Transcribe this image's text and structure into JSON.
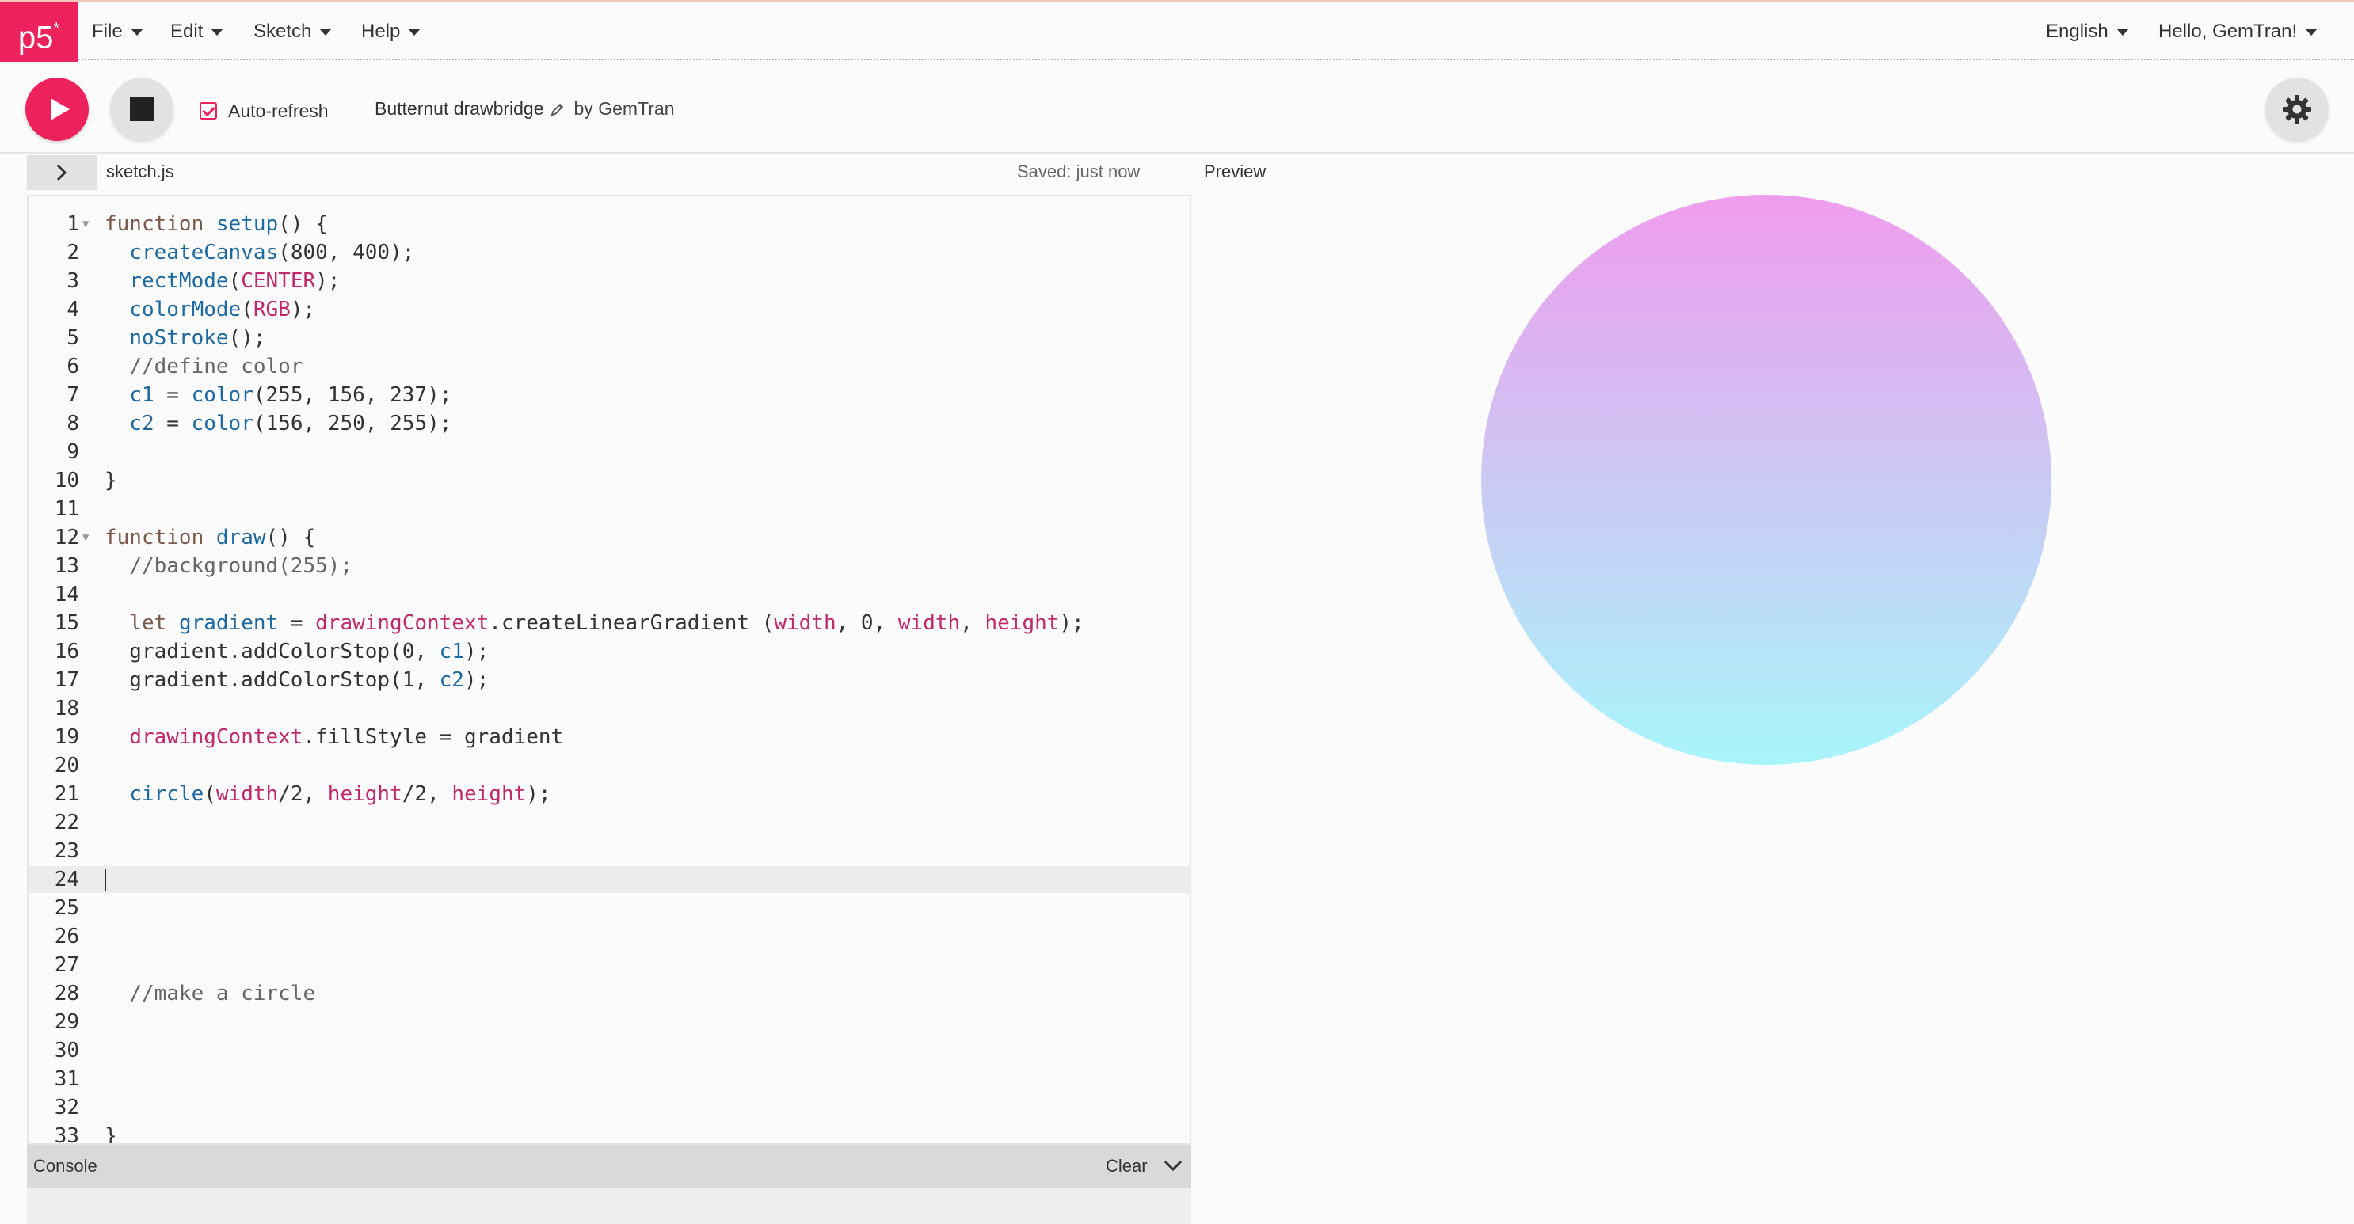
{
  "nav": {
    "logo": "p5*",
    "menus": [
      "File",
      "Edit",
      "Sketch",
      "Help"
    ],
    "language": "English",
    "user_greeting": "Hello, GemTran!"
  },
  "toolbar": {
    "play_icon": "play-icon",
    "stop_icon": "stop-icon",
    "auto_refresh_label": "Auto-refresh",
    "auto_refresh_checked": true,
    "sketch_name": "Butternut drawbridge",
    "by_label": "by",
    "author": "GemTran",
    "settings_icon": "gear-icon"
  },
  "editor_header": {
    "filename": "sketch.js",
    "saved_status": "Saved: just now",
    "preview_label": "Preview"
  },
  "editor": {
    "active_line": 24,
    "lines": [
      {
        "n": "1",
        "text": "function setup() {"
      },
      {
        "n": "2",
        "text": "  createCanvas(800, 400);"
      },
      {
        "n": "3",
        "text": "  rectMode(CENTER);"
      },
      {
        "n": "4",
        "text": "  colorMode(RGB);"
      },
      {
        "n": "5",
        "text": "  noStroke();"
      },
      {
        "n": "6",
        "text": "  //define color"
      },
      {
        "n": "7",
        "text": "  c1 = color(255, 156, 237);"
      },
      {
        "n": "8",
        "text": "  c2 = color(156, 250, 255);"
      },
      {
        "n": "9",
        "text": ""
      },
      {
        "n": "10",
        "text": "}"
      },
      {
        "n": "11",
        "text": ""
      },
      {
        "n": "12",
        "text": "function draw() {"
      },
      {
        "n": "13",
        "text": "  //background(255);"
      },
      {
        "n": "14",
        "text": ""
      },
      {
        "n": "15",
        "text": "  let gradient = drawingContext.createLinearGradient (width, 0, width, height);"
      },
      {
        "n": "16",
        "text": "  gradient.addColorStop(0, c1);"
      },
      {
        "n": "17",
        "text": "  gradient.addColorStop(1, c2);"
      },
      {
        "n": "18",
        "text": ""
      },
      {
        "n": "19",
        "text": "  drawingContext.fillStyle = gradient"
      },
      {
        "n": "20",
        "text": ""
      },
      {
        "n": "21",
        "text": "  circle(width/2, height/2, height);"
      },
      {
        "n": "22",
        "text": ""
      },
      {
        "n": "23",
        "text": ""
      },
      {
        "n": "24",
        "text": ""
      },
      {
        "n": "25",
        "text": ""
      },
      {
        "n": "26",
        "text": ""
      },
      {
        "n": "27",
        "text": ""
      },
      {
        "n": "28",
        "text": "  //make a circle"
      },
      {
        "n": "29",
        "text": ""
      },
      {
        "n": "30",
        "text": ""
      },
      {
        "n": "31",
        "text": ""
      },
      {
        "n": "32",
        "text": ""
      },
      {
        "n": "33",
        "text": "}"
      }
    ],
    "fold_lines": [
      1,
      12
    ]
  },
  "console": {
    "label": "Console",
    "clear_label": "Clear"
  },
  "preview": {
    "gradient_top": "#ef9ced",
    "gradient_bottom": "#a8f5fb"
  },
  "colors": {
    "accent": "#ed225d",
    "keyword": "#7a5a4a",
    "function": "#1f6aa0",
    "p5_constant": "#c02a6d",
    "comment": "#666666"
  }
}
